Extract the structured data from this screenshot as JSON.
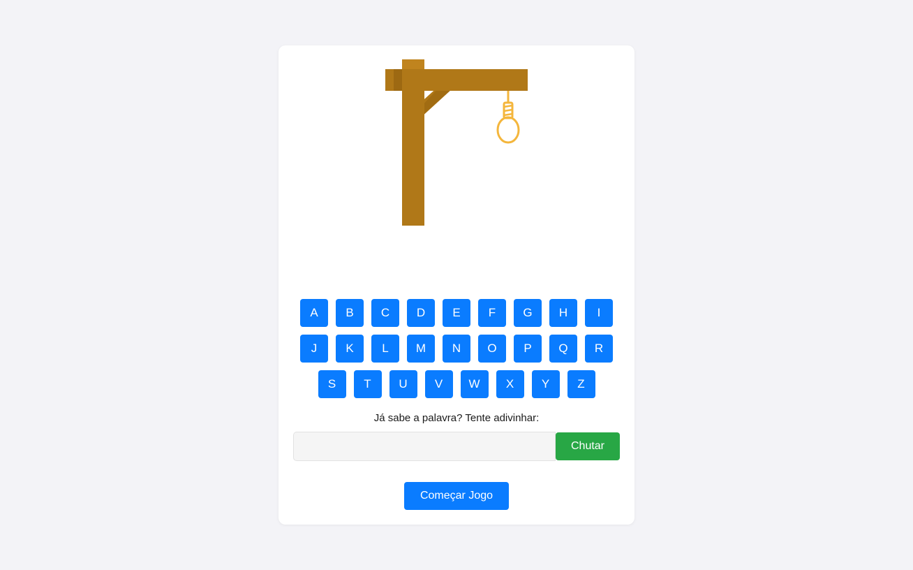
{
  "keyboard": {
    "rows": [
      [
        "A",
        "B",
        "C",
        "D",
        "E",
        "F",
        "G",
        "H",
        "I"
      ],
      [
        "J",
        "K",
        "L",
        "M",
        "N",
        "O",
        "P",
        "Q",
        "R"
      ],
      [
        "S",
        "T",
        "U",
        "V",
        "W",
        "X",
        "Y",
        "Z"
      ]
    ]
  },
  "guess": {
    "prompt": "Já sabe a palavra? Tente adivinhar:",
    "input_value": "",
    "input_placeholder": "",
    "button_label": "Chutar"
  },
  "start_button_label": "Começar Jogo",
  "colors": {
    "background": "#f3f3f7",
    "key": "#0a7cff",
    "guess_button": "#28a745",
    "wood": "#b07818",
    "wood_dark": "#96620f",
    "rope": "#f4b63c"
  },
  "icons": {
    "gallows": "gallows-icon",
    "noose": "noose-icon"
  }
}
